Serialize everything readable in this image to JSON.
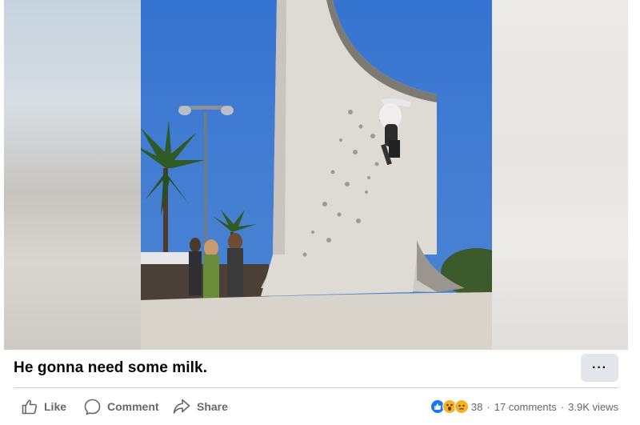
{
  "post": {
    "caption": "He gonna need some milk.",
    "more_label": "···"
  },
  "actions": {
    "like_label": "Like",
    "comment_label": "Comment",
    "share_label": "Share"
  },
  "stats": {
    "reaction_count": "38",
    "separator": "·",
    "comments": "17 comments",
    "views": "3.9K views",
    "reaction_icons": [
      "like-icon",
      "wow-icon",
      "sad-icon"
    ]
  },
  "colors": {
    "like_blue": "#1877f2",
    "reaction_yellow": "#f7b125",
    "muted_text": "#65676b",
    "button_bg": "#e4e6eb",
    "divider": "#ced0d4"
  }
}
